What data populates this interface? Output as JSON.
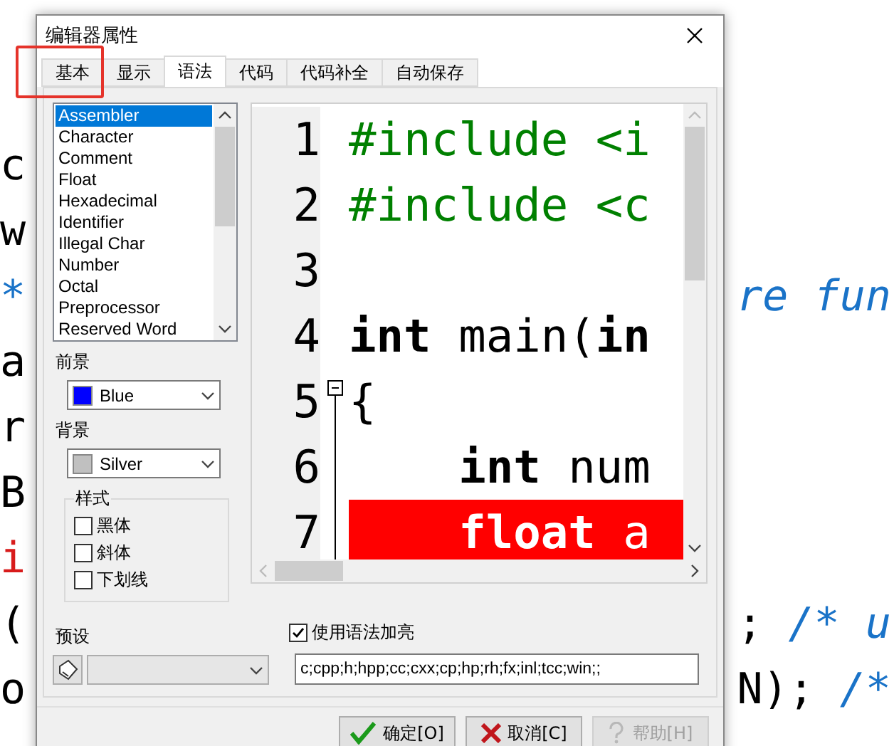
{
  "background_editor": {
    "lines": [
      {
        "left": [
          {
            "text": "c",
            "kind": "plain"
          }
        ]
      },
      {
        "left": [
          {
            "text": "w",
            "kind": "plain"
          }
        ]
      },
      {
        "left": [
          {
            "text": "*",
            "kind": "comment"
          }
        ],
        "right": [
          {
            "text": "re fun",
            "kind": "comment"
          }
        ]
      },
      {
        "left": [
          {
            "text": "a",
            "kind": "plain"
          }
        ]
      },
      {
        "left": [
          {
            "text": "r",
            "kind": "plain"
          }
        ]
      },
      {
        "left": [
          {
            "text": "B",
            "kind": "plain"
          }
        ]
      },
      {
        "left": [
          {
            "text": "i",
            "kind": "error"
          }
        ]
      },
      {
        "left": [
          {
            "text": "(",
            "kind": "plain"
          }
        ],
        "right": [
          {
            "text": ";",
            "kind": "plain"
          },
          {
            "text": "/* u",
            "kind": "comment"
          }
        ]
      },
      {
        "left": [
          {
            "text": "o",
            "kind": "plain"
          }
        ],
        "right": [
          {
            "text": "N);",
            "kind": "plain"
          },
          {
            "text": "/*",
            "kind": "comment"
          }
        ]
      }
    ]
  },
  "dialog": {
    "title": "编辑器属性",
    "tabs": [
      {
        "label": "基本",
        "selected": false,
        "highlighted": true
      },
      {
        "label": "显示",
        "selected": false,
        "highlighted": false
      },
      {
        "label": "语法",
        "selected": true,
        "highlighted": false
      },
      {
        "label": "代码",
        "selected": false,
        "highlighted": false
      },
      {
        "label": "代码补全",
        "selected": false,
        "highlighted": false
      },
      {
        "label": "自动保存",
        "selected": false,
        "highlighted": false
      }
    ],
    "elements": [
      {
        "label": "Assembler",
        "selected": true
      },
      {
        "label": "Character",
        "selected": false
      },
      {
        "label": "Comment",
        "selected": false
      },
      {
        "label": "Float",
        "selected": false
      },
      {
        "label": "Hexadecimal",
        "selected": false
      },
      {
        "label": "Identifier",
        "selected": false
      },
      {
        "label": "Illegal Char",
        "selected": false
      },
      {
        "label": "Number",
        "selected": false
      },
      {
        "label": "Octal",
        "selected": false
      },
      {
        "label": "Preprocessor",
        "selected": false
      },
      {
        "label": "Reserved Word",
        "selected": false
      }
    ],
    "foreground": {
      "label": "前景",
      "value": "Blue",
      "color": "#0000ff"
    },
    "background": {
      "label": "背景",
      "value": "Silver",
      "color": "#c0c0c0"
    },
    "style": {
      "label": "样式",
      "options": [
        {
          "label": "黑体",
          "checked": false
        },
        {
          "label": "斜体",
          "checked": false
        },
        {
          "label": "下划线",
          "checked": false
        }
      ]
    },
    "preview": {
      "lines": [
        {
          "number": "1",
          "highlighted": false,
          "fold_marker": false,
          "segments": [
            {
              "text": "#include <i",
              "kind": "preprocessor"
            }
          ]
        },
        {
          "number": "2",
          "highlighted": false,
          "fold_marker": false,
          "segments": [
            {
              "text": "#include <c",
              "kind": "preprocessor"
            }
          ]
        },
        {
          "number": "3",
          "highlighted": false,
          "fold_marker": false
        },
        {
          "number": "4",
          "highlighted": false,
          "fold_marker": false,
          "segments": [
            {
              "text": "int",
              "kind": "keyword"
            },
            {
              "text": " main(",
              "kind": "plain"
            },
            {
              "text": "in",
              "kind": "keyword"
            }
          ]
        },
        {
          "number": "5",
          "highlighted": false,
          "fold_marker": true,
          "segments": [
            {
              "text": "{",
              "kind": "plain"
            }
          ]
        },
        {
          "number": "6",
          "highlighted": false,
          "fold_marker": false,
          "segments": [
            {
              "text": "    int",
              "kind": "keyword"
            },
            {
              "text": " num",
              "kind": "plain"
            }
          ]
        },
        {
          "number": "7",
          "highlighted": true,
          "fold_marker": false,
          "segments": [
            {
              "text": "    float",
              "kind": "keyword"
            },
            {
              "text": " a",
              "kind": "plain"
            }
          ]
        }
      ]
    },
    "preset": {
      "label": "预设"
    },
    "syntax_highlight": {
      "label": "使用语法加亮",
      "checked": true
    },
    "extensions": {
      "value": "c;cpp;h;hpp;cc;cxx;cp;hp;rh;fx;inl;tcc;win;;"
    },
    "buttons": [
      {
        "label": "确定[O]",
        "kind": "ok",
        "disabled": false
      },
      {
        "label": "取消[C]",
        "kind": "cancel",
        "disabled": false
      },
      {
        "label": "帮助[H]",
        "kind": "help",
        "disabled": true
      }
    ]
  }
}
